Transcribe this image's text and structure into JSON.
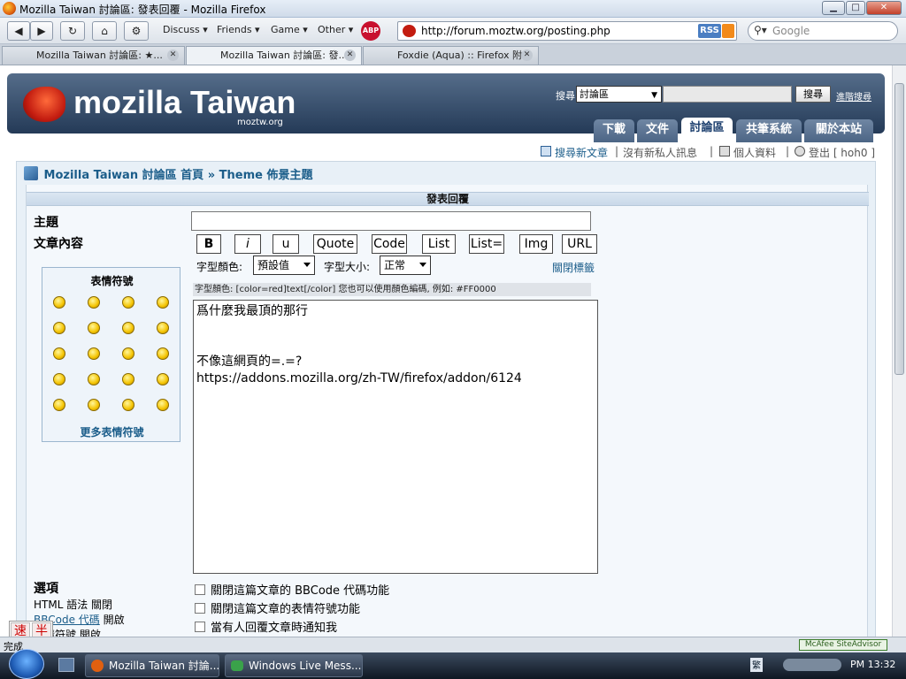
{
  "window": {
    "title": "Mozilla Taiwan 討論區: 發表回覆 - Mozilla Firefox"
  },
  "toolbar": {
    "menus": [
      "Discuss",
      "Friends",
      "Game",
      "Other"
    ],
    "url": "http://forum.moztw.org/posting.php",
    "rss": "RSS",
    "search_placeholder": "Google"
  },
  "tabs": [
    {
      "label": "Mozilla Taiwan 討論區: ★..."
    },
    {
      "label": "Mozilla Taiwan 討論區: 發..."
    },
    {
      "label": "Foxdie (Aqua) :: Firefox 附..."
    }
  ],
  "header": {
    "logo_text": "mozilla Taiwan",
    "logo_sub": "moztw.org",
    "search_label": "搜尋",
    "search_scope": "討論區",
    "search_button": "搜尋",
    "advanced_search": "進階搜尋",
    "nav": [
      "下載",
      "文件",
      "討論區",
      "共筆系統",
      "關於本站"
    ],
    "active_nav": "討論區"
  },
  "userbar": {
    "search_new": "搜尋新文章",
    "no_pm": "沒有新私人訊息",
    "profile": "個人資料",
    "logout": "登出 [ hoh0 ]"
  },
  "breadcrumb": {
    "home": "Mozilla Taiwan 討論區 首頁",
    "sep": "»",
    "forum": "Theme 佈景主題"
  },
  "form": {
    "header": "發表回覆",
    "subject_label": "主題",
    "body_label": "文章內容",
    "bbcode_buttons": [
      "B",
      "i",
      "u",
      "Quote",
      "Code",
      "List",
      "List=",
      "Img",
      "URL"
    ],
    "font_color_label": "字型顏色:",
    "font_color_value": "預設值",
    "font_size_label": "字型大小:",
    "font_size_value": "正常",
    "close_tags": "關閉標籤",
    "helpline": "字型顏色: [color=red]text[/color]  您也可以使用顏色編碼, 例如: #FF0000",
    "message": "爲什麼我最頂的那行\n\n\n不像這網頁的=.=?\nhttps://addons.mozilla.org/zh-TW/firefox/addon/6124",
    "smilies_title": "表情符號",
    "more_smilies": "更多表情符號",
    "options_label": "選項",
    "html_status": "HTML 語法 關閉",
    "bbcode_status_link": "BBCode 代碼",
    "bbcode_status": "開啟",
    "smilies_status": "表情符號 開啟",
    "option_disable_bbcode": "關閉這篇文章的 BBCode 代碼功能",
    "option_disable_smilies": "關閉這篇文章的表情符號功能",
    "option_notify": "當有人回覆文章時通知我"
  },
  "statusbar": {
    "text": "完成",
    "mcafee": "McAfee SiteAdvisor"
  },
  "taskbar": {
    "items": [
      "Mozilla Taiwan 討論...",
      "Windows Live Mess..."
    ],
    "clock": "PM 13:32"
  },
  "ime": {
    "a": "速",
    "b": "半"
  }
}
